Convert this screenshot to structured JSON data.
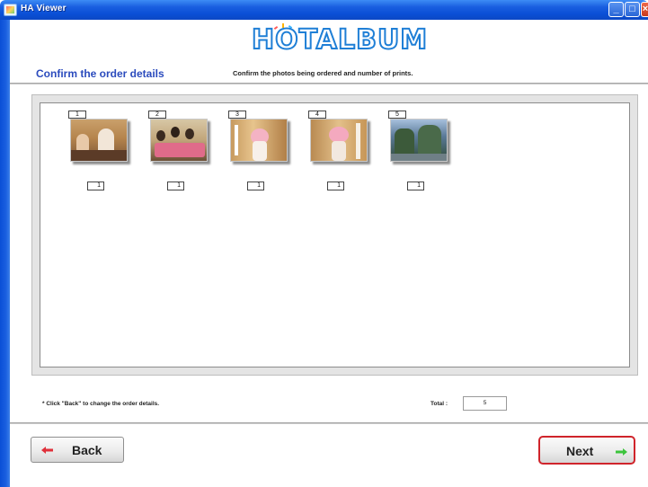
{
  "window": {
    "title": "HA Viewer"
  },
  "header": {
    "logo_text": "HOTALBUM",
    "title": "Confirm the order details",
    "description": "Confirm the photos being ordered and number of prints."
  },
  "photos": [
    {
      "number": "1",
      "quantity": "1"
    },
    {
      "number": "2",
      "quantity": "1"
    },
    {
      "number": "3",
      "quantity": "1"
    },
    {
      "number": "4",
      "quantity": "1"
    },
    {
      "number": "5",
      "quantity": "1"
    }
  ],
  "footer": {
    "note": "* Click \"Back\" to change the order details.",
    "total_label": "Total :",
    "total_value": "5",
    "back_label": "Back",
    "next_label": "Next"
  },
  "colors": {
    "title_bar": "#0a4fd6",
    "header_title": "#2b4bbd",
    "next_highlight": "#d0242b",
    "back_arrow": "#e0303a",
    "next_arrow": "#3cc43c"
  },
  "icons": {
    "back": "arrow-left-icon",
    "next": "arrow-right-icon"
  }
}
